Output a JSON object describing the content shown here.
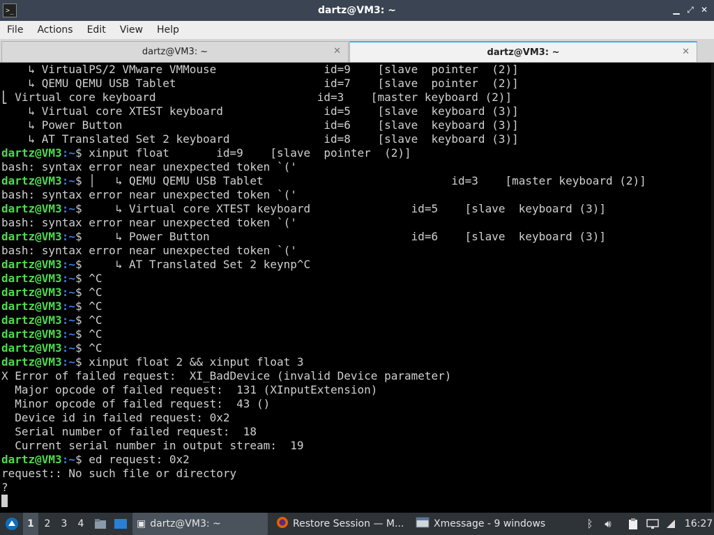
{
  "window": {
    "title": "dartz@VM3: ~",
    "app_icon": "terminal-icon",
    "controls": [
      "minimize-icon",
      "maximize-icon",
      "close-icon"
    ]
  },
  "menu": [
    "File",
    "Actions",
    "Edit",
    "View",
    "Help"
  ],
  "tabs": [
    {
      "label": "dartz@VM3: ~",
      "active": false
    },
    {
      "label": "dartz@VM3: ~",
      "active": true
    }
  ],
  "terminal": {
    "prompt_user": "dartz@VM3",
    "prompt_path": ":~",
    "prompt_dollar": "$ ",
    "lines": [
      {
        "text": "    ↳ VirtualPS/2 VMware VMMouse                id=9    [slave  pointer  (2)]"
      },
      {
        "text": "    ↳ QEMU QEMU USB Tablet                      id=7    [slave  pointer  (2)]"
      },
      {
        "text": "⎣ Virtual core keyboard                        id=3    [master keyboard (2)]"
      },
      {
        "text": "    ↳ Virtual core XTEST keyboard               id=5    [slave  keyboard (3)]"
      },
      {
        "text": "    ↳ Power Button                              id=6    [slave  keyboard (3)]"
      },
      {
        "text": "    ↳ AT Translated Set 2 keyboard              id=8    [slave  keyboard (3)]"
      },
      {
        "prompt": true,
        "text": "xinput float       id=9    [slave  pointer  (2)]"
      },
      {
        "text": "bash: syntax error near unexpected token `('"
      },
      {
        "prompt": true,
        "text": "│   ↳ QEMU QEMU USB Tablet                            id=3    [master keyboard (2)]"
      },
      {
        "text": "bash: syntax error near unexpected token `('"
      },
      {
        "prompt": true,
        "text": "    ↳ Virtual core XTEST keyboard               id=5    [slave  keyboard (3)]"
      },
      {
        "text": "bash: syntax error near unexpected token `('"
      },
      {
        "prompt": true,
        "text": "    ↳ Power Button                              id=6    [slave  keyboard (3)]"
      },
      {
        "text": "bash: syntax error near unexpected token `('"
      },
      {
        "prompt": true,
        "text": "    ↳ AT Translated Set 2 keynp^C"
      },
      {
        "prompt": true,
        "text": "^C"
      },
      {
        "prompt": true,
        "text": "^C"
      },
      {
        "prompt": true,
        "text": "^C"
      },
      {
        "prompt": true,
        "text": "^C"
      },
      {
        "prompt": true,
        "text": "^C"
      },
      {
        "prompt": true,
        "text": "^C"
      },
      {
        "prompt": true,
        "text": "xinput float 2 && xinput float 3"
      },
      {
        "text": "X Error of failed request:  XI_BadDevice (invalid Device parameter)"
      },
      {
        "text": "  Major opcode of failed request:  131 (XInputExtension)"
      },
      {
        "text": "  Minor opcode of failed request:  43 ()"
      },
      {
        "text": "  Device id in failed request: 0x2"
      },
      {
        "text": "  Serial number of failed request:  18"
      },
      {
        "text": "  Current serial number in output stream:  19"
      },
      {
        "prompt": true,
        "text": "ed request: 0x2"
      },
      {
        "text": "request:: No such file or directory"
      },
      {
        "text": "?"
      },
      {
        "text": "",
        "cursor": true
      }
    ]
  },
  "taskbar": {
    "start_icon": "lubuntu-logo-icon",
    "workspaces": [
      "1",
      "2",
      "3",
      "4"
    ],
    "active_workspace": "1",
    "launchers": [
      "file-manager-icon",
      "show-desktop-icon"
    ],
    "tasks": [
      {
        "label": "dartz@VM3: ~",
        "icon": "terminal-icon",
        "active": true
      },
      {
        "label": "Restore Session — M...",
        "icon": "firefox-icon",
        "active": false
      },
      {
        "label": "Xmessage - 9 windows",
        "icon": "window-icon",
        "active": false
      }
    ],
    "tray": [
      "bluetooth-icon",
      "volume-icon",
      "clipboard-icon",
      "network-icon",
      "power-icon"
    ],
    "clock": "16:27"
  }
}
